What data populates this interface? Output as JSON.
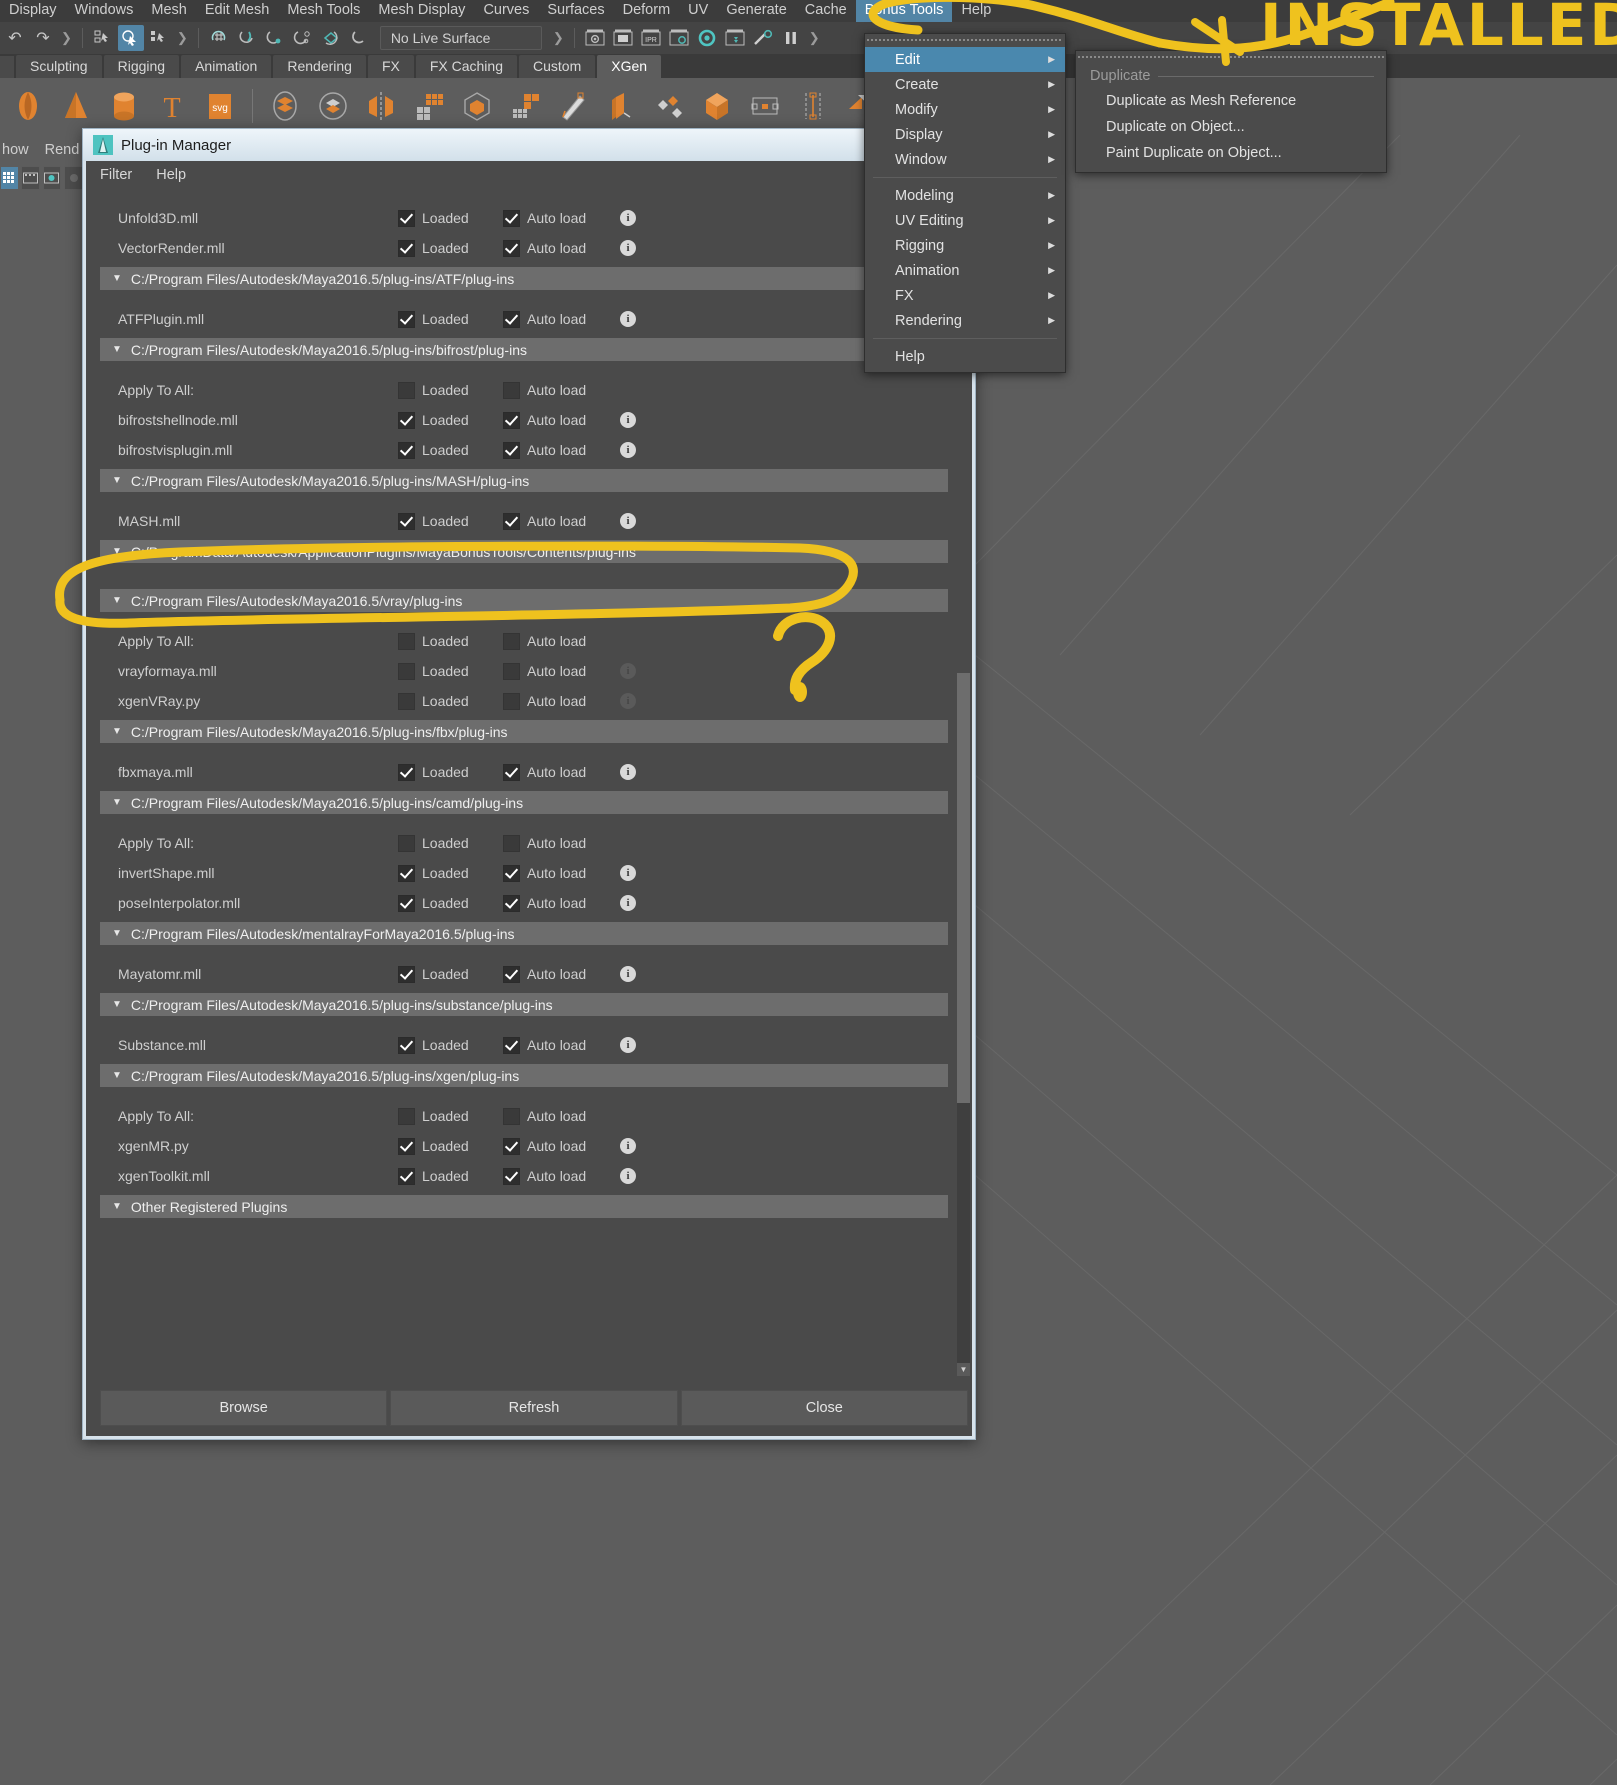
{
  "app": {
    "menubar": [
      {
        "label": "Display",
        "active": false
      },
      {
        "label": "Windows",
        "active": false
      },
      {
        "label": "Mesh",
        "active": false
      },
      {
        "label": "Edit Mesh",
        "active": false
      },
      {
        "label": "Mesh Tools",
        "active": false
      },
      {
        "label": "Mesh Display",
        "active": false
      },
      {
        "label": "Curves",
        "active": false
      },
      {
        "label": "Surfaces",
        "active": false
      },
      {
        "label": "Deform",
        "active": false
      },
      {
        "label": "UV",
        "active": false
      },
      {
        "label": "Generate",
        "active": false
      },
      {
        "label": "Cache",
        "active": false
      },
      {
        "label": "Bonus Tools",
        "active": true
      },
      {
        "label": "Help",
        "active": false
      }
    ],
    "toolbar": {
      "live_surface_value": "No Live Surface",
      "icons": [
        "undo-icon",
        "redo-icon",
        "select-hierarchy-icon",
        "select-object-icon",
        "select-component-icon",
        "snap-grid-icon",
        "snap-curve-icon",
        "snap-point-icon",
        "snap-projected-center-icon",
        "snap-view-plane-icon",
        "snap-construction-icon",
        "render-view-icon",
        "render-region-icon",
        "ipr-render-icon",
        "render-settings-icon",
        "hypershade-icon",
        "render-setup-icon",
        "light-settings-icon",
        "pause-render-icon"
      ]
    },
    "shelf_tabs": [
      {
        "label": "Sculpting",
        "active": false
      },
      {
        "label": "Rigging",
        "active": false
      },
      {
        "label": "Animation",
        "active": false
      },
      {
        "label": "Rendering",
        "active": false
      },
      {
        "label": "FX",
        "active": false
      },
      {
        "label": "FX Caching",
        "active": false
      },
      {
        "label": "Custom",
        "active": false
      },
      {
        "label": "XGen",
        "active": true
      }
    ],
    "shelf_icons": [
      "polygon-sphere-icon",
      "polygon-cone-icon",
      "polygon-cylinder-icon",
      "text-icon",
      "svg-icon",
      "sculpt-shape-icon",
      "smooth-shape-icon",
      "mirror-geometry-icon",
      "grid-icon",
      "cube-icon",
      "quad-draw-icon",
      "sculpt-tool-icon",
      "extrude-icon",
      "multi-cut-icon",
      "bevel-icon",
      "pivot-icon",
      "distance-icon",
      "bridge-icon",
      "snap-together-icon"
    ],
    "left_partial_labels": [
      "how",
      "Rend"
    ]
  },
  "bonus_tools_menu": {
    "name": "Bonus Tools",
    "items": [
      {
        "label": "Edit",
        "submenu": true,
        "highlighted": true
      },
      {
        "label": "Create",
        "submenu": true,
        "highlighted": false
      },
      {
        "label": "Modify",
        "submenu": true,
        "highlighted": false
      },
      {
        "label": "Display",
        "submenu": true,
        "highlighted": false
      },
      {
        "label": "Window",
        "submenu": true,
        "highlighted": false
      },
      {
        "separator": true
      },
      {
        "label": "Modeling",
        "submenu": true,
        "highlighted": false
      },
      {
        "label": "UV Editing",
        "submenu": true,
        "highlighted": false
      },
      {
        "label": "Rigging",
        "submenu": true,
        "highlighted": false
      },
      {
        "label": "Animation",
        "submenu": true,
        "highlighted": false
      },
      {
        "label": "FX",
        "submenu": true,
        "highlighted": false
      },
      {
        "label": "Rendering",
        "submenu": true,
        "highlighted": false
      },
      {
        "separator": true
      },
      {
        "label": "Help",
        "submenu": false,
        "highlighted": false
      }
    ]
  },
  "duplicate_submenu": {
    "header": "Duplicate",
    "items": [
      {
        "label": "Duplicate as Mesh Reference"
      },
      {
        "label": "Duplicate on Object..."
      },
      {
        "label": "Paint Duplicate on Object..."
      }
    ]
  },
  "plugin_manager": {
    "title": "Plug-in Manager",
    "title_icon": "maya-app-icon",
    "window_buttons": [
      "minimize-button",
      "maximize-button",
      "close-button"
    ],
    "menus": [
      "Filter",
      "Help"
    ],
    "column_labels": {
      "loaded": "Loaded",
      "auto_load": "Auto load",
      "apply_all": "Apply To All:"
    },
    "sections": [
      {
        "path": null,
        "rows": [
          {
            "name": "Unfold3D.mll",
            "loaded": true,
            "auto_load": true,
            "info": true
          },
          {
            "name": "VectorRender.mll",
            "loaded": true,
            "auto_load": true,
            "info": true
          }
        ]
      },
      {
        "path": "C:/Program Files/Autodesk/Maya2016.5/plug-ins/ATF/plug-ins",
        "rows": [
          {
            "name": "ATFPlugin.mll",
            "loaded": true,
            "auto_load": true,
            "info": true
          }
        ]
      },
      {
        "path": "C:/Program Files/Autodesk/Maya2016.5/plug-ins/bifrost/plug-ins",
        "rows": [
          {
            "name": "Apply To All:",
            "loaded": false,
            "auto_load": false,
            "info": false,
            "apply_all": true
          },
          {
            "name": "bifrostshellnode.mll",
            "loaded": true,
            "auto_load": true,
            "info": true
          },
          {
            "name": "bifrostvisplugin.mll",
            "loaded": true,
            "auto_load": true,
            "info": true
          }
        ]
      },
      {
        "path": "C:/Program Files/Autodesk/Maya2016.5/plug-ins/MASH/plug-ins",
        "rows": [
          {
            "name": "MASH.mll",
            "loaded": true,
            "auto_load": true,
            "info": true
          }
        ]
      },
      {
        "path": "C:/ProgramData/Autodesk/ApplicationPlugins/MayaBonusTools/Contents/plug-ins",
        "rows": []
      },
      {
        "path": "C:/Program Files/Autodesk/Maya2016.5/vray/plug-ins",
        "rows": [
          {
            "name": "Apply To All:",
            "loaded": false,
            "auto_load": false,
            "info": false,
            "apply_all": true
          },
          {
            "name": "vrayformaya.mll",
            "loaded": false,
            "auto_load": false,
            "info": true,
            "info_dim": true
          },
          {
            "name": "xgenVRay.py",
            "loaded": false,
            "auto_load": false,
            "info": true,
            "info_dim": true
          }
        ]
      },
      {
        "path": "C:/Program Files/Autodesk/Maya2016.5/plug-ins/fbx/plug-ins",
        "rows": [
          {
            "name": "fbxmaya.mll",
            "loaded": true,
            "auto_load": true,
            "info": true
          }
        ]
      },
      {
        "path": "C:/Program Files/Autodesk/Maya2016.5/plug-ins/camd/plug-ins",
        "rows": [
          {
            "name": "Apply To All:",
            "loaded": false,
            "auto_load": false,
            "info": false,
            "apply_all": true
          },
          {
            "name": "invertShape.mll",
            "loaded": true,
            "auto_load": true,
            "info": true
          },
          {
            "name": "poseInterpolator.mll",
            "loaded": true,
            "auto_load": true,
            "info": true
          }
        ]
      },
      {
        "path": "C:/Program Files/Autodesk/mentalrayForMaya2016.5/plug-ins",
        "rows": [
          {
            "name": "Mayatomr.mll",
            "loaded": true,
            "auto_load": true,
            "info": true
          }
        ]
      },
      {
        "path": "C:/Program Files/Autodesk/Maya2016.5/plug-ins/substance/plug-ins",
        "rows": [
          {
            "name": "Substance.mll",
            "loaded": true,
            "auto_load": true,
            "info": true
          }
        ]
      },
      {
        "path": "C:/Program Files/Autodesk/Maya2016.5/plug-ins/xgen/plug-ins",
        "rows": [
          {
            "name": "Apply To All:",
            "loaded": false,
            "auto_load": false,
            "info": false,
            "apply_all": true
          },
          {
            "name": "xgenMR.py",
            "loaded": true,
            "auto_load": true,
            "info": true
          },
          {
            "name": "xgenToolkit.mll",
            "loaded": true,
            "auto_load": true,
            "info": true
          }
        ]
      },
      {
        "path": "Other Registered Plugins",
        "rows": []
      }
    ],
    "footer_buttons": [
      {
        "label": "Browse"
      },
      {
        "label": "Refresh"
      },
      {
        "label": "Close"
      }
    ]
  },
  "annotations": {
    "color": "#efc21e",
    "installed_text": "INSTALLED",
    "question_mark": "?",
    "circled_path": "C:/ProgramData/Autodesk/ApplicationPlugins/MayaBonusTools/Contents/plug-ins",
    "arrow_target": "Bonus Tools"
  },
  "colors": {
    "accent_blue": "#5285a6",
    "menu_highlight": "#4a88ae",
    "panel_bg": "#4a4a4a",
    "group_header": "#6d6d6d",
    "viewport_bg": "#5d5d5d",
    "shelf_orange": "#e08330",
    "annotation_yellow": "#efc21e"
  }
}
